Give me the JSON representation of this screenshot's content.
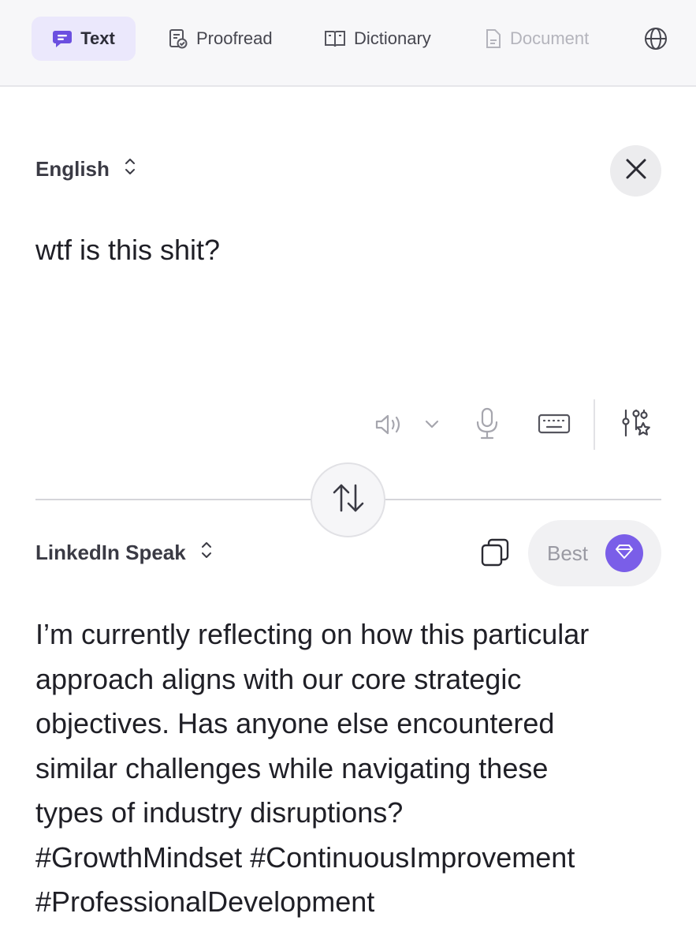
{
  "tabs": [
    {
      "label": "Text",
      "icon": "chat-bubble-icon",
      "active": true
    },
    {
      "label": "Proofread",
      "icon": "proofread-icon"
    },
    {
      "label": "Dictionary",
      "icon": "book-icon"
    },
    {
      "label": "Document",
      "icon": "document-icon",
      "disabled": true
    },
    {
      "icon": "globe-icon"
    }
  ],
  "source": {
    "language": "English",
    "text": "wtf is this shit?"
  },
  "target": {
    "language": "LinkedIn Speak",
    "quality_label": "Best",
    "lines": [
      "I’m currently reflecting on how this particular",
      "approach aligns with our core strategic",
      "objectives. Has anyone else encountered",
      "similar challenges while navigating these",
      "types of industry disruptions?",
      "#GrowthMindset #ContinuousImprovement",
      "#ProfessionalDevelopment"
    ]
  },
  "colors": {
    "accent": "#7a5ee8",
    "active_tab_bg": "#ebe8fc",
    "tabbar_bg": "#f7f7f9"
  }
}
